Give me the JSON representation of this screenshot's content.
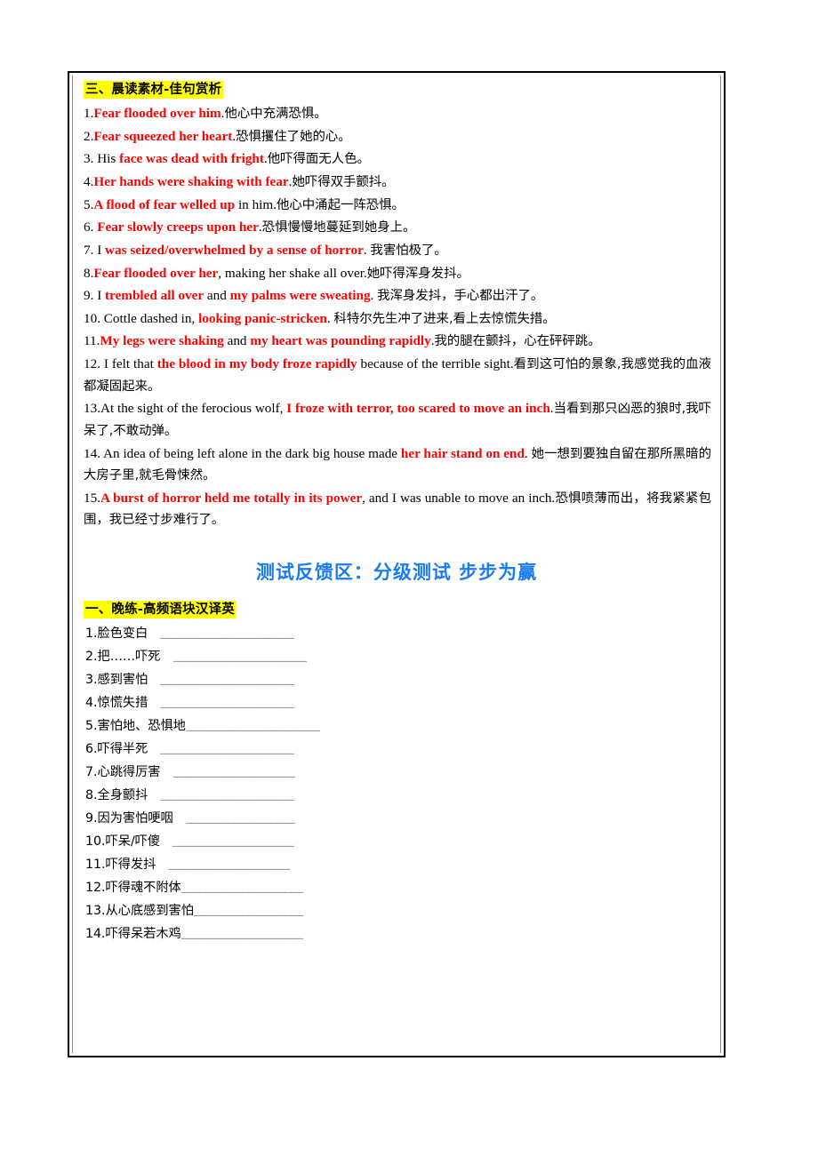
{
  "document": {
    "sections": {
      "morning_reading": {
        "heading": "三、晨读素材-佳句赏析",
        "sentences": [
          {
            "num": "1.",
            "parts": [
              {
                "t": "Fear flooded over him",
                "style": "red-en"
              },
              {
                "t": ".",
                "style": "en"
              },
              {
                "t": "他心中充满恐惧。",
                "style": "cn"
              }
            ]
          },
          {
            "num": "2.",
            "parts": [
              {
                "t": "Fear squeezed her heart",
                "style": "red-en"
              },
              {
                "t": ".",
                "style": "en"
              },
              {
                "t": "恐惧攫住了她的心。",
                "style": "cn"
              }
            ]
          },
          {
            "num": "3. ",
            "parts": [
              {
                "t": "His ",
                "style": "en"
              },
              {
                "t": "face was dead with fright",
                "style": "red-en"
              },
              {
                "t": ".",
                "style": "en"
              },
              {
                "t": "他吓得面无人色。",
                "style": "cn"
              }
            ]
          },
          {
            "num": "4.",
            "parts": [
              {
                "t": "Her hands were shaking with fear",
                "style": "red-en"
              },
              {
                "t": ".",
                "style": "en"
              },
              {
                "t": "她吓得双手颤抖。",
                "style": "cn"
              }
            ]
          },
          {
            "num": "5.",
            "parts": [
              {
                "t": "A flood of fear welled up",
                "style": "red-en"
              },
              {
                "t": " in him.",
                "style": "en"
              },
              {
                "t": "他心中涌起一阵恐惧。",
                "style": "cn"
              }
            ]
          },
          {
            "num": "6. ",
            "parts": [
              {
                "t": "Fear slowly creeps upon her",
                "style": "red-en"
              },
              {
                "t": ".",
                "style": "en"
              },
              {
                "t": "恐惧慢慢地蔓延到她身上。",
                "style": "cn"
              }
            ]
          },
          {
            "num": "7. ",
            "parts": [
              {
                "t": "I ",
                "style": "en"
              },
              {
                "t": "was seized/overwhelmed by a sense of horror",
                "style": "red-en"
              },
              {
                "t": ". ",
                "style": "en"
              },
              {
                "t": "我害怕极了。",
                "style": "cn"
              }
            ]
          },
          {
            "num": "8.",
            "parts": [
              {
                "t": "Fear flooded over her",
                "style": "red-en"
              },
              {
                "t": ", making her shake all over.",
                "style": "en"
              },
              {
                "t": "她吓得浑身发抖。",
                "style": "cn"
              }
            ]
          },
          {
            "num": "9. ",
            "parts": [
              {
                "t": "I ",
                "style": "en"
              },
              {
                "t": "trembled all over",
                "style": "red-en"
              },
              {
                "t": " and ",
                "style": "en"
              },
              {
                "t": "my palms were sweating",
                "style": "red-en"
              },
              {
                "t": ". ",
                "style": "en"
              },
              {
                "t": "我浑身发抖，手心都出汗了。",
                "style": "cn"
              }
            ]
          },
          {
            "num": "10. ",
            "parts": [
              {
                "t": "Cottle dashed in, ",
                "style": "en"
              },
              {
                "t": "looking panic-stricken",
                "style": "red-en"
              },
              {
                "t": ". ",
                "style": "en"
              },
              {
                "t": "科特尔先生冲了进来,看上去惊慌失措。",
                "style": "cn"
              }
            ]
          },
          {
            "num": "11.",
            "parts": [
              {
                "t": "My legs were shaking",
                "style": "red-en"
              },
              {
                "t": " and ",
                "style": "en"
              },
              {
                "t": "my heart was pounding rapidly",
                "style": "red-en"
              },
              {
                "t": ".",
                "style": "en"
              },
              {
                "t": "我的腿在颤抖，心在砰砰跳。",
                "style": "cn"
              }
            ]
          },
          {
            "num": "12. ",
            "parts": [
              {
                "t": "I felt that ",
                "style": "en"
              },
              {
                "t": "the blood in my body froze rapidly",
                "style": "red-en"
              },
              {
                "t": " because of the terrible sight.",
                "style": "en"
              },
              {
                "t": "看到这可怕的景象,我感觉我的血液都凝固起来。",
                "style": "cn"
              }
            ]
          },
          {
            "num": "13.",
            "parts": [
              {
                "t": "At the sight of the ferocious wolf, ",
                "style": "en"
              },
              {
                "t": "I froze with terror, too scared to move an inch",
                "style": "red-en"
              },
              {
                "t": ".",
                "style": "en"
              },
              {
                "t": "当看到那只凶恶的狼时,我吓呆了,不敢动弹。",
                "style": "cn"
              }
            ]
          },
          {
            "num": "14. ",
            "parts": [
              {
                "t": "An idea of being left alone in the dark big house made ",
                "style": "en"
              },
              {
                "t": "her hair stand on end",
                "style": "red-en"
              },
              {
                "t": ". ",
                "style": "en"
              },
              {
                "t": "她一想到要独自留在那所黑暗的大房子里,就毛骨悚然。",
                "style": "cn"
              }
            ]
          },
          {
            "num": "15.",
            "parts": [
              {
                "t": "A burst of horror held me totally in its power",
                "style": "red-en"
              },
              {
                "t": ", and I was unable to move an inch.",
                "style": "en"
              },
              {
                "t": "恐惧喷薄而出，将我紧紧包围，我已经寸步难行了。",
                "style": "cn"
              }
            ]
          }
        ]
      },
      "test_feedback": {
        "title": "测试反馈区：分级测试 步步为赢",
        "title_color": "#1b7ced",
        "exercise_heading": "一、晚练-高频语块汉译英",
        "items": [
          {
            "num": "1.",
            "label": "脸色变白",
            "blank": "______________________",
            "tight": false
          },
          {
            "num": "2.",
            "label": "把……吓死",
            "blank": "______________________",
            "tight": false
          },
          {
            "num": "3.",
            "label": "感到害怕",
            "blank": "______________________",
            "tight": false
          },
          {
            "num": "4.",
            "label": "惊慌失措",
            "blank": "______________________",
            "tight": false
          },
          {
            "num": "5.",
            "label": "害怕地、恐惧地",
            "blank": "______________________",
            "tight": true
          },
          {
            "num": "6.",
            "label": "吓得半死",
            "blank": "______________________",
            "tight": false
          },
          {
            "num": "7.",
            "label": "心跳得厉害",
            "blank": "____________________",
            "tight": false
          },
          {
            "num": "8.",
            "label": "全身颤抖",
            "blank": "______________________",
            "tight": false
          },
          {
            "num": "9.",
            "label": "因为害怕哽咽",
            "blank": "__________________",
            "tight": false
          },
          {
            "num": "10.",
            "label": "吓呆/吓傻",
            "blank": "____________________",
            "tight": false
          },
          {
            "num": "11.",
            "label": "吓得发抖",
            "blank": "____________________",
            "tight": false
          },
          {
            "num": "12.",
            "label": "吓得魂不附体",
            "blank": "____________________",
            "tight": true
          },
          {
            "num": "13.",
            "label": "从心底感到害怕",
            "blank": "__________________",
            "tight": true
          },
          {
            "num": "14.",
            "label": "吓得呆若木鸡",
            "blank": "____________________",
            "tight": true
          }
        ]
      }
    }
  }
}
